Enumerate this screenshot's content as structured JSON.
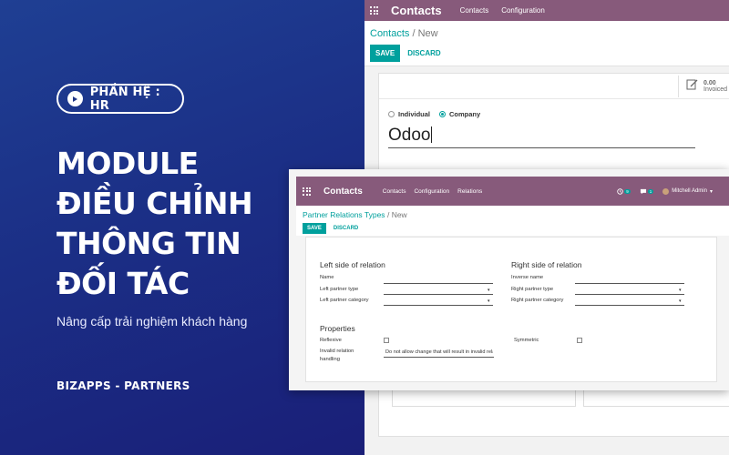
{
  "promo": {
    "pill_text": "PHẦN HỆ : HR",
    "headline": [
      "MODULE",
      "ĐIỀU CHỈNH",
      "THÔNG TIN",
      "ĐỐI TÁC"
    ],
    "subtitle": "Nâng cấp trải nghiệm khách hàng",
    "brand": "BIZAPPS - PARTNERS",
    "colors": {
      "bg_top": "#1f3f93",
      "bg_bottom": "#1a1f78"
    }
  },
  "back_window": {
    "app_name": "Contacts",
    "menu": [
      "Contacts",
      "Configuration"
    ],
    "breadcrumb": {
      "parent": "Contacts",
      "separator": "/",
      "current": "New"
    },
    "save_label": "SAVE",
    "discard_label": "DISCARD",
    "invoiced": {
      "value": "0.00",
      "label": "Invoiced"
    },
    "company_type": {
      "options": [
        "Individual",
        "Company"
      ],
      "selected": "Company"
    },
    "name_value": "Odoo"
  },
  "front_window": {
    "app_name": "Contacts",
    "menu": [
      "Contacts",
      "Configuration",
      "Relations"
    ],
    "activity_count": "9",
    "message_count": "1",
    "user_name": "Mitchell Admin",
    "breadcrumb": {
      "parent": "Partner Relations Types",
      "separator": "/",
      "current": "New"
    },
    "save_label": "SAVE",
    "discard_label": "DISCARD",
    "left_section": {
      "title": "Left side of relation",
      "fields": [
        "Name",
        "Left partner type",
        "Left partner category"
      ]
    },
    "right_section": {
      "title": "Right side of relation",
      "fields": [
        "Inverse name",
        "Right partner type",
        "Right partner category"
      ]
    },
    "properties": {
      "title": "Properties",
      "reflexive_label": "Reflexive",
      "symmetric_label": "Symmetric",
      "invalid_label_1": "Invalid relation",
      "invalid_label_2": "handling",
      "invalid_value": "Do not allow change that will result in invalid relations"
    }
  },
  "colors": {
    "odoo_purple": "#875a7b",
    "odoo_teal": "#00a09d"
  }
}
